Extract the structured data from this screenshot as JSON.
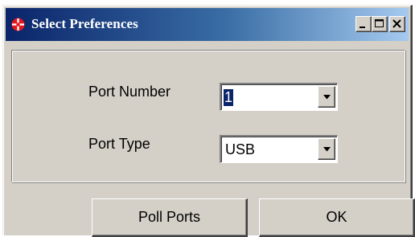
{
  "window": {
    "title": "Select Preferences",
    "icon": "red-app-icon",
    "caption_buttons": [
      "minimize-icon",
      "maximize-icon",
      "close-icon"
    ]
  },
  "form": {
    "port_number": {
      "label": "Port Number",
      "value": "1"
    },
    "port_type": {
      "label": "Port Type",
      "value": "USB"
    }
  },
  "buttons": {
    "poll_ports": "Poll Ports",
    "ok": "OK"
  },
  "colors": {
    "titlebar_start": "#0a246a",
    "titlebar_end": "#a6caf0",
    "face": "#d4d0c8",
    "selection": "#0a246a",
    "app_icon": "#e8141c"
  }
}
